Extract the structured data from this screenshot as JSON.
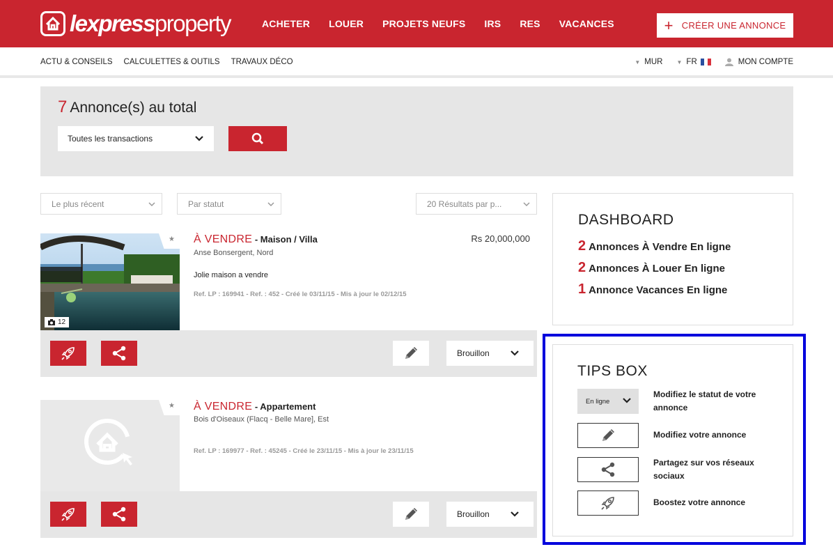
{
  "brand": {
    "bold": "lexpress",
    "light": "property"
  },
  "mainnav": [
    "ACHETER",
    "LOUER",
    "PROJETS NEUFS",
    "IRS",
    "RES",
    "VACANCES"
  ],
  "create_btn": {
    "plus": "+",
    "label": "CRÉER UNE ANNONCE"
  },
  "subnav": {
    "left": [
      "ACTU & CONSEILS",
      "CALCULETTES & OUTILS",
      "TRAVAUX DÉCO"
    ],
    "currency": "MUR",
    "lang": "FR",
    "account": "MON COMPTE"
  },
  "search": {
    "count": "7",
    "count_label": "Annonce(s) au total",
    "transaction_select": "Toutes les transactions"
  },
  "filters": {
    "sort": "Le plus récent",
    "status": "Par statut",
    "per_page": "20 Résultats par p..."
  },
  "listings": [
    {
      "type": "À VENDRE",
      "subtype": " - Maison / Villa",
      "location": "Anse Bonsergent, Nord",
      "description": "Jolie maison a vendre",
      "ref": "Ref. LP : 169941 - Ref. : 452 - Créé le 03/11/15 - Mis à jour le 02/12/15",
      "price": "Rs 20,000,000",
      "photos": "12",
      "status": "Brouillon"
    },
    {
      "type": "À VENDRE",
      "subtype": " - Appartement",
      "location": "Bois d'Oiseaux (Flacq - Belle Mare], Est",
      "ref": "Ref. LP : 169977 - Ref. : 45245 - Créé le 23/11/15 - Mis à jour le 23/11/15",
      "status": "Brouillon"
    }
  ],
  "dashboard": {
    "title": "DASHBOARD",
    "rows": [
      {
        "n": "2",
        "label": "Annonces À Vendre En ligne"
      },
      {
        "n": "2",
        "label": "Annonces À Louer En ligne"
      },
      {
        "n": "1",
        "label": "Annonce Vacances En ligne"
      }
    ]
  },
  "tips": {
    "title": "TIPS BOX",
    "status_example": "En ligne",
    "items": [
      "Modifiez le statut de votre annonce",
      "Modifiez votre annonce",
      "Partagez sur vos réseaux sociaux",
      "Boostez votre annonce"
    ]
  },
  "colors": {
    "brand": "#c9252f",
    "highlight": "#0000dd",
    "panel": "#e6e6e6"
  }
}
